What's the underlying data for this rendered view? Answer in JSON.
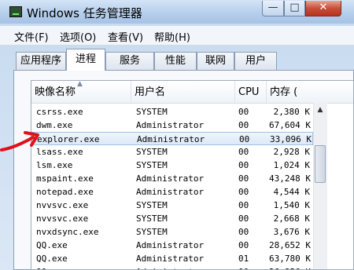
{
  "window": {
    "title": "Windows 任务管理器"
  },
  "menu": [
    "文件(F)",
    "选项(O)",
    "查看(V)",
    "帮助(H)"
  ],
  "tabs": [
    "应用程序",
    "进程",
    "服务",
    "性能",
    "联网",
    "用户"
  ],
  "active_tab": "进程",
  "columns": {
    "name": "映像名称",
    "user": "用户名",
    "cpu": "CPU",
    "mem": "内存 ("
  },
  "rows": [
    {
      "name": "csrss.exe",
      "user": "SYSTEM",
      "cpu": "00",
      "mem": "2,380 K"
    },
    {
      "name": "dwm.exe",
      "user": "Administrator",
      "cpu": "00",
      "mem": "67,604 K"
    },
    {
      "name": "explorer.exe",
      "user": "Administrator",
      "cpu": "00",
      "mem": "33,096 K"
    },
    {
      "name": "lsass.exe",
      "user": "SYSTEM",
      "cpu": "00",
      "mem": "2,928 K"
    },
    {
      "name": "lsm.exe",
      "user": "SYSTEM",
      "cpu": "00",
      "mem": "1,024 K"
    },
    {
      "name": "mspaint.exe",
      "user": "Administrator",
      "cpu": "00",
      "mem": "43,248 K"
    },
    {
      "name": "notepad.exe",
      "user": "Administrator",
      "cpu": "00",
      "mem": "4,544 K"
    },
    {
      "name": "nvvsvc.exe",
      "user": "SYSTEM",
      "cpu": "00",
      "mem": "1,540 K"
    },
    {
      "name": "nvvsvc.exe",
      "user": "SYSTEM",
      "cpu": "00",
      "mem": "2,668 K"
    },
    {
      "name": "nvxdsync.exe",
      "user": "SYSTEM",
      "cpu": "00",
      "mem": "3,676 K"
    },
    {
      "name": "QQ.exe",
      "user": "Administrator",
      "cpu": "00",
      "mem": "28,652 K"
    },
    {
      "name": "QQ.exe",
      "user": "Administrator",
      "cpu": "01",
      "mem": "63,780 K"
    },
    {
      "name": "QQ.exe",
      "user": "Administrator",
      "cpu": "00",
      "mem": "26,856 K"
    }
  ],
  "selected_row": 2,
  "colors": {
    "selection": "#dce9f8",
    "annotation_arrow": "#e0101a"
  }
}
